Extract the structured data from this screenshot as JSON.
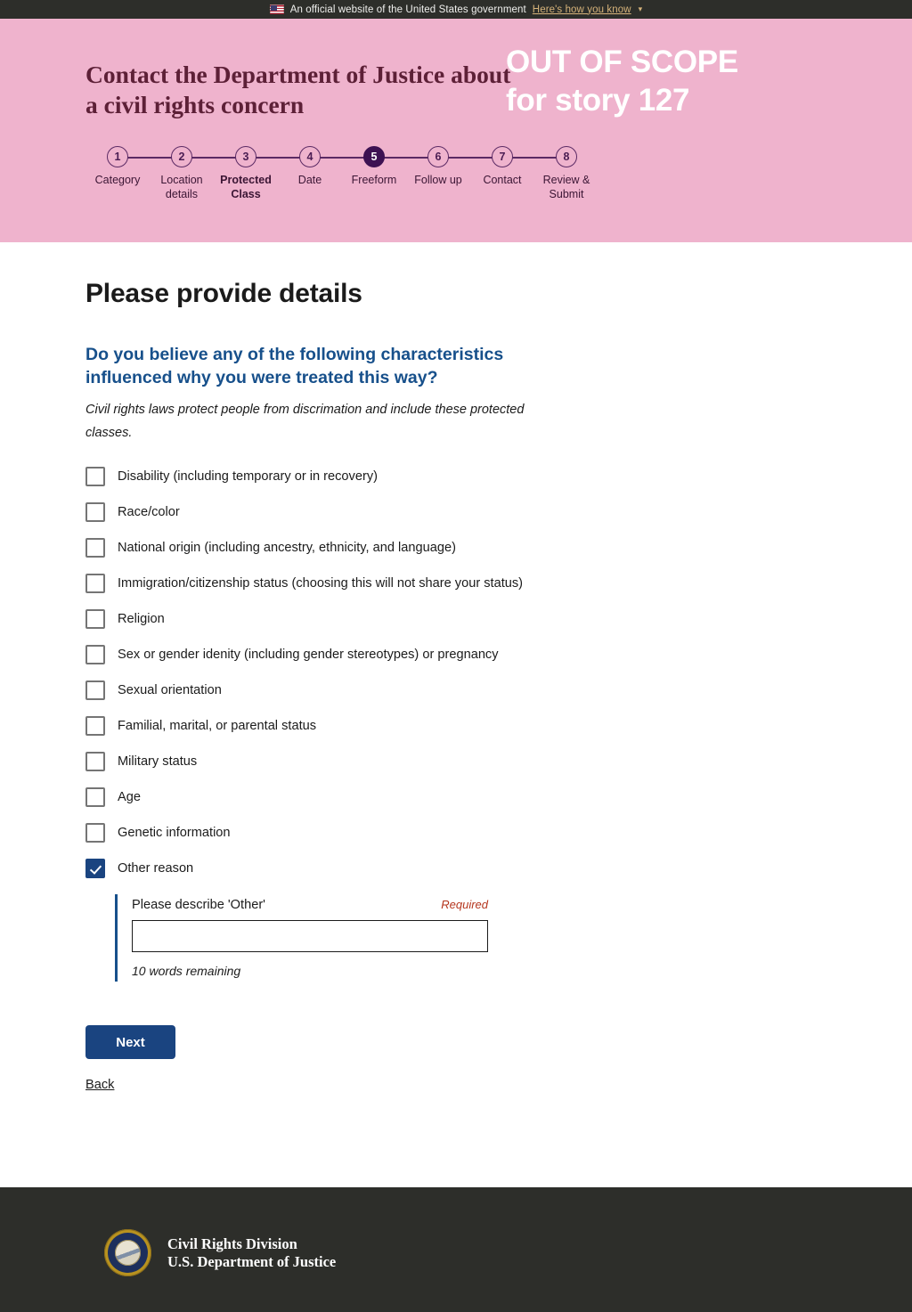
{
  "gov_banner": {
    "flag_icon": "us-flag-icon",
    "text": "An official website of the United States government",
    "link_label": "Here's how you know",
    "chevron_icon": "chevron-down-icon"
  },
  "header": {
    "site_title": "Contact the Department of Justice about a civil rights concern",
    "overlay_line1": "OUT OF SCOPE",
    "overlay_line2": "for story 127",
    "background_color": "#efb3cd",
    "title_color": "#5d2037",
    "steps": [
      {
        "number": "1",
        "label": "Category",
        "state": "todo"
      },
      {
        "number": "2",
        "label": "Location details",
        "state": "todo"
      },
      {
        "number": "3",
        "label": "Protected Class",
        "state": "current"
      },
      {
        "number": "4",
        "label": "Date",
        "state": "todo"
      },
      {
        "number": "5",
        "label": "Freeform",
        "state": "active"
      },
      {
        "number": "6",
        "label": "Follow up",
        "state": "todo"
      },
      {
        "number": "7",
        "label": "Contact",
        "state": "todo"
      },
      {
        "number": "8",
        "label": "Review & Submit",
        "state": "todo"
      }
    ],
    "step_active_color": "#3d1152",
    "step_outline_color": "#5b2a64"
  },
  "main": {
    "page_title": "Please provide details",
    "question": "Do you believe any of the following characteristics influenced why you were treated this way?",
    "question_color": "#17508b",
    "hint": "Civil rights laws protect people from discrimation and include these protected classes.",
    "options": [
      {
        "label": "Disability (including temporary or in recovery)",
        "checked": false
      },
      {
        "label": "Race/color",
        "checked": false
      },
      {
        "label": "National origin (including ancestry, ethnicity, and language)",
        "checked": false
      },
      {
        "label": "Immigration/citizenship status (choosing this will not share your status)",
        "checked": false
      },
      {
        "label": "Religion",
        "checked": false
      },
      {
        "label": "Sex or gender idenity (including gender stereotypes) or pregnancy",
        "checked": false
      },
      {
        "label": "Sexual orientation",
        "checked": false
      },
      {
        "label": "Familial, marital, or parental status",
        "checked": false
      },
      {
        "label": "Military status",
        "checked": false
      },
      {
        "label": "Age",
        "checked": false
      },
      {
        "label": "Genetic information",
        "checked": false
      },
      {
        "label": "Other reason",
        "checked": true
      }
    ],
    "checkbox_checked_color": "#1a4480",
    "other_field": {
      "label": "Please describe 'Other'",
      "required_tag": "Required",
      "value": "",
      "placeholder": "",
      "words_remaining": "10 words remaining"
    },
    "next_label": "Next",
    "back_label": "Back",
    "button_color": "#1a4480"
  },
  "footer": {
    "seal_icon": "doj-seal-icon",
    "line1": "Civil Rights Division",
    "line2": "U.S. Department of Justice",
    "background_color": "#2d2e2a"
  }
}
